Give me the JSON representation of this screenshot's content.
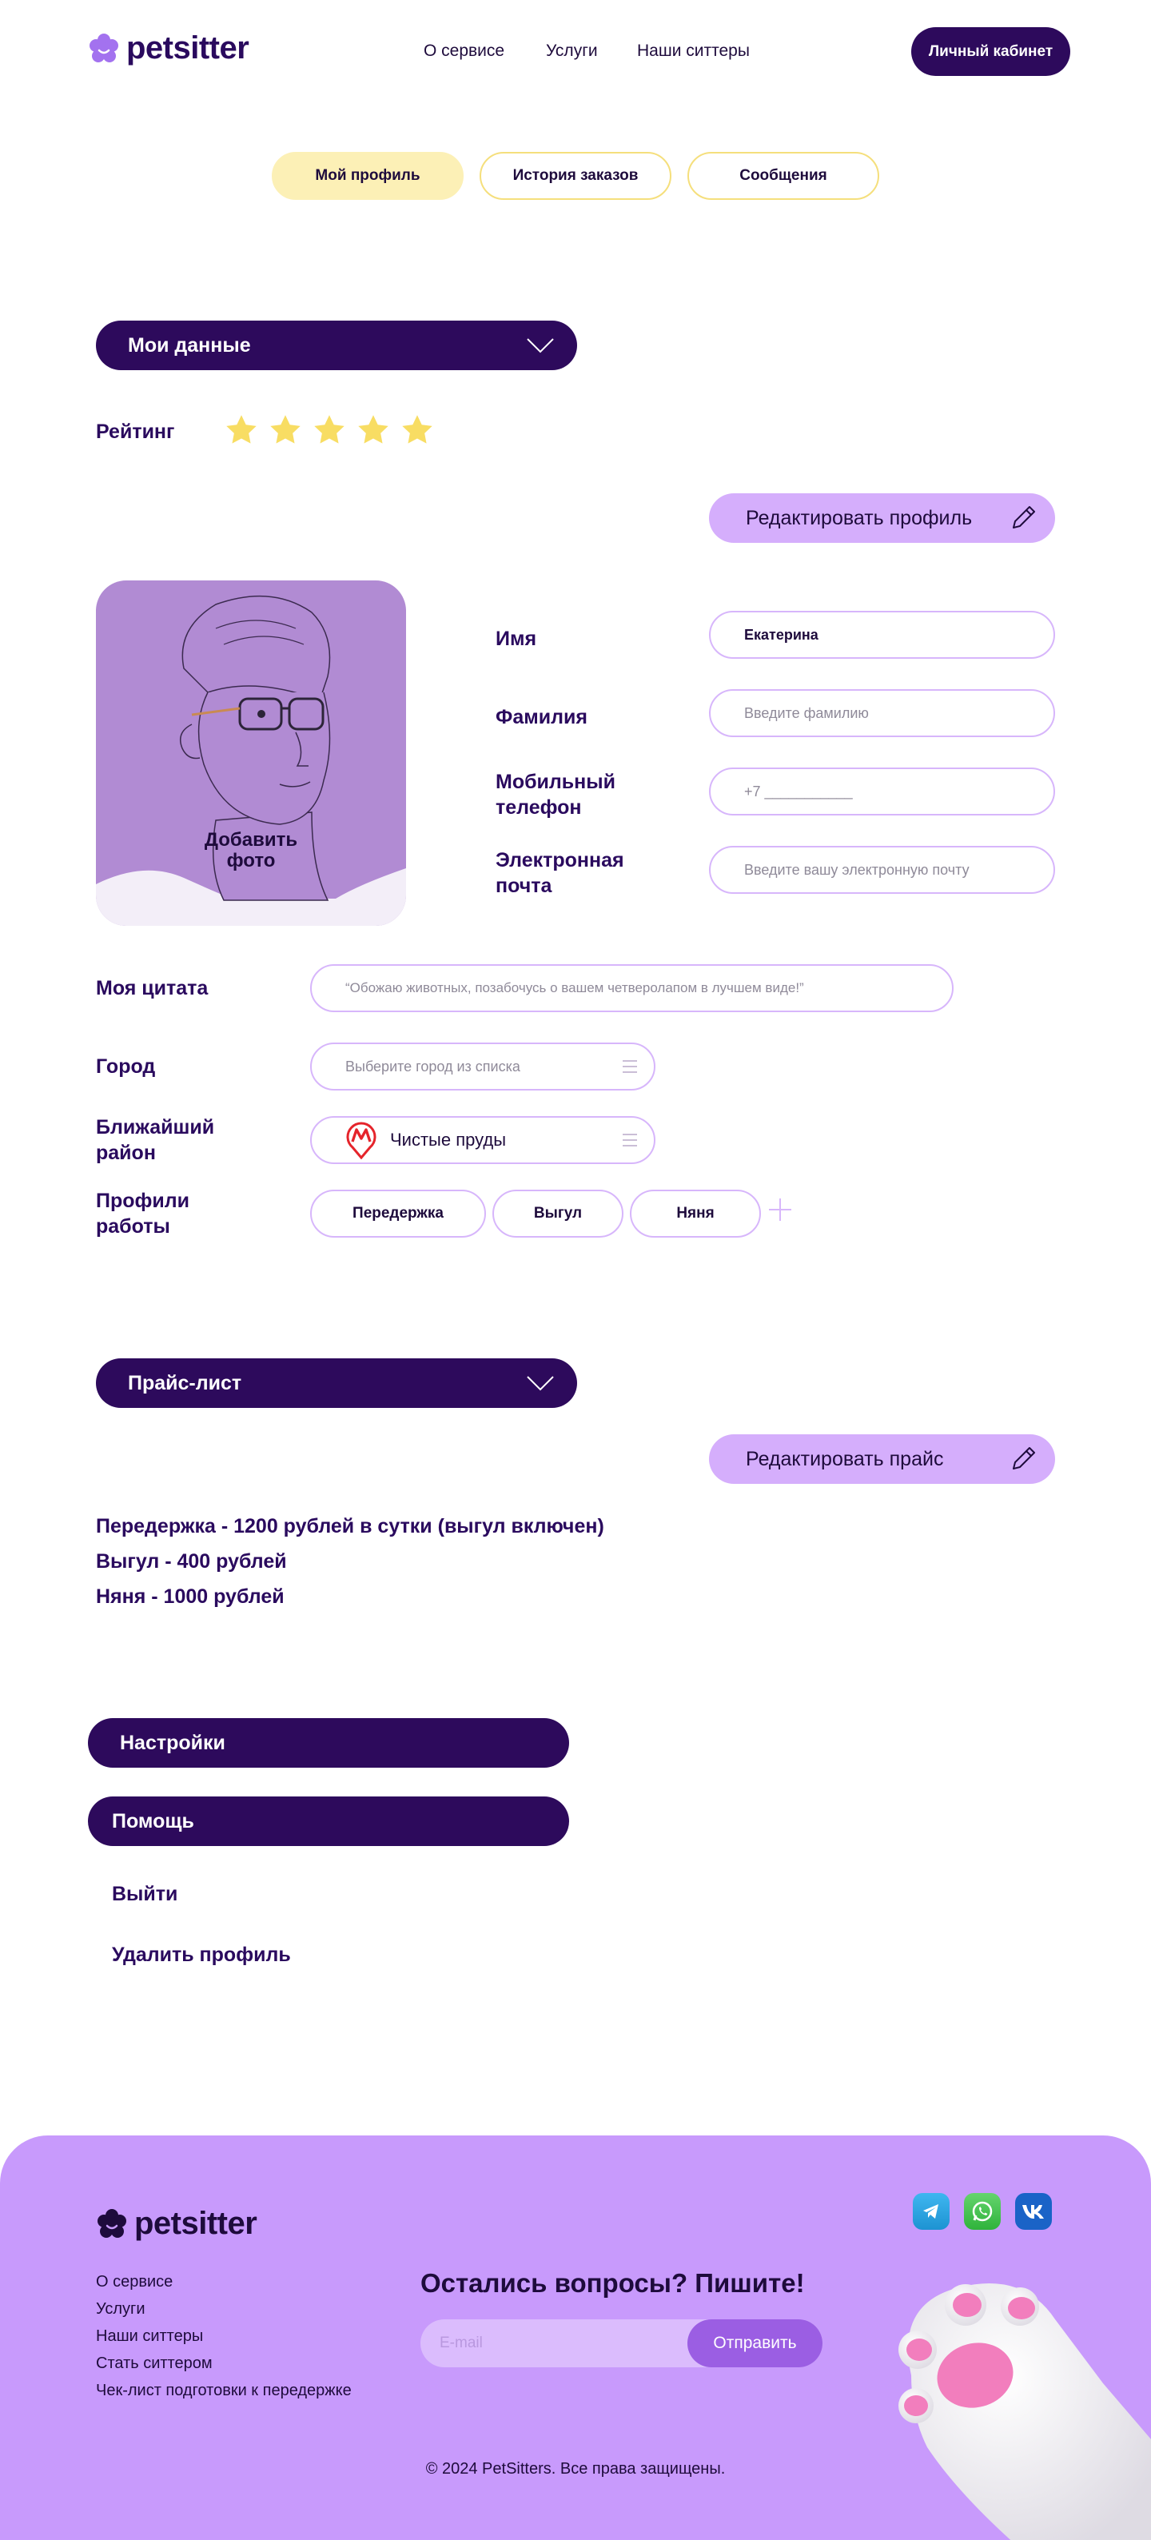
{
  "header": {
    "logo_text": "petsitter",
    "nav": [
      "О сервисе",
      "Услуги",
      "Наши ситтеры"
    ],
    "cabinet_button": "Личный кабинет"
  },
  "tabs": [
    "Мой профиль",
    "История заказов",
    "Сообщения"
  ],
  "my_data": {
    "section_title": "Мои данные",
    "rating_label": "Рейтинг",
    "rating_stars": 5,
    "edit_profile_button": "Редактировать профиль",
    "add_photo": [
      "Добавить",
      "фото"
    ],
    "fields": {
      "first_name_label": "Имя",
      "first_name_value": "Екатерина",
      "last_name_label": "Фамилия",
      "last_name_placeholder": "Введите фамилию",
      "phone_label": [
        "Мобильный",
        "телефон"
      ],
      "phone_placeholder": "+7 ___________",
      "email_label": [
        "Электронная",
        "почта"
      ],
      "email_placeholder": "Введите вашу электронную почту"
    },
    "quote_label": "Моя цитата",
    "quote_placeholder": "“Обожаю животных, позабочусь о вашем четверолапом в лучшем виде!”",
    "city_label": "Город",
    "city_placeholder": "Выберите город из списка",
    "district_label": [
      "Ближайший",
      "район"
    ],
    "district_value": "Чистые пруды",
    "work_profiles_label": [
      "Профили",
      "работы"
    ],
    "work_profiles": [
      "Передержка",
      "Выгул",
      "Няня"
    ]
  },
  "price_list": {
    "section_title": "Прайс-лист",
    "edit_button": "Редактировать прайс",
    "items": [
      "Передержка - 1200 рублей в сутки (выгул включен)",
      "Выгул - 400 рублей",
      "Няня - 1000 рублей"
    ]
  },
  "settings_title": "Настройки",
  "help_title": "Помощь",
  "logout": "Выйти",
  "delete_profile": "Удалить профиль",
  "footer": {
    "logo_text": "petsitter",
    "links": [
      "О сервисе",
      "Услуги",
      "Наши ситтеры",
      "Стать ситтером",
      "Чек-лист подготовки к передержке"
    ],
    "cta_title": "Остались вопросы? Пишите!",
    "email_placeholder": "E-mail",
    "send_button": "Отправить",
    "copyright": "© 2024 PetSitters. Все права защищены.",
    "socials": [
      "telegram-icon",
      "whatsapp-icon",
      "vk-icon"
    ]
  },
  "colors": {
    "brand_dark": "#2d0a5c",
    "brand_light": "#c89afc",
    "accent_yellow": "#f5df7c",
    "star": "#f8dd63"
  }
}
